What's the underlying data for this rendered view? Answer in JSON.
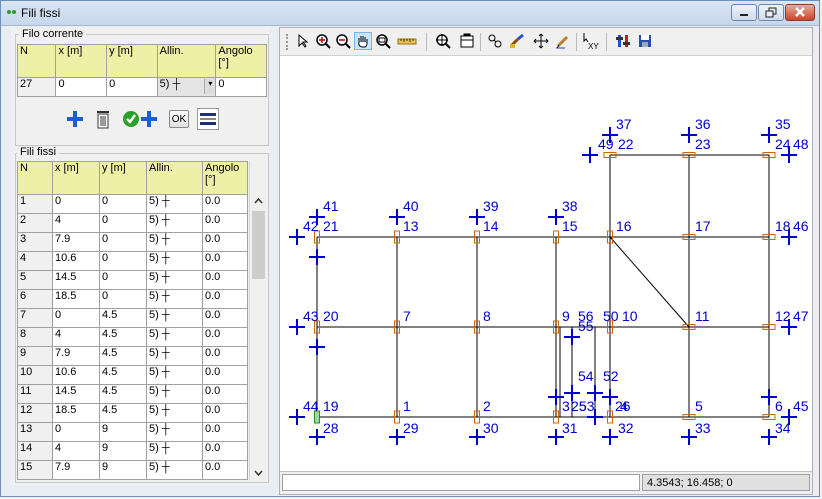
{
  "window": {
    "title": "Fili fissi"
  },
  "current": {
    "group_title": "Filo corrente",
    "headers": [
      "N",
      "x [m]",
      "y [m]",
      "Allin.",
      "Angolo [°]"
    ],
    "row": [
      "27",
      "0",
      "0",
      "5) ┼",
      "0"
    ]
  },
  "buttons": {
    "ok_label": "OK"
  },
  "list": {
    "group_title": "Fili fissi",
    "headers": [
      "N",
      "x [m]",
      "y [m]",
      "Allin.",
      "Angolo [°]"
    ],
    "rows": [
      [
        "1",
        "0",
        "0",
        "5) ┼",
        "0.0"
      ],
      [
        "2",
        "4",
        "0",
        "5) ┼",
        "0.0"
      ],
      [
        "3",
        "7.9",
        "0",
        "5) ┼",
        "0.0"
      ],
      [
        "4",
        "10.6",
        "0",
        "5) ┼",
        "0.0"
      ],
      [
        "5",
        "14.5",
        "0",
        "5) ┼",
        "0.0"
      ],
      [
        "6",
        "18.5",
        "0",
        "5) ┼",
        "0.0"
      ],
      [
        "7",
        "0",
        "4.5",
        "5) ┼",
        "0.0"
      ],
      [
        "8",
        "4",
        "4.5",
        "5) ┼",
        "0.0"
      ],
      [
        "9",
        "7.9",
        "4.5",
        "5) ┼",
        "0.0"
      ],
      [
        "10",
        "10.6",
        "4.5",
        "5) ┼",
        "0.0"
      ],
      [
        "11",
        "14.5",
        "4.5",
        "5) ┼",
        "0.0"
      ],
      [
        "12",
        "18.5",
        "4.5",
        "5) ┼",
        "0.0"
      ],
      [
        "13",
        "0",
        "9",
        "5) ┼",
        "0.0"
      ],
      [
        "14",
        "4",
        "9",
        "5) ┼",
        "0.0"
      ],
      [
        "15",
        "7.9",
        "9",
        "5) ┼",
        "0.0"
      ]
    ]
  },
  "toolbar": {
    "tools": [
      "select-arrow-icon",
      "zoom-in-icon",
      "zoom-out-icon",
      "pan-hand-icon",
      "zoom-window-icon",
      "measure-ruler-icon",
      "zoom-extents-icon",
      "zoom-previous-icon",
      "snap-icon",
      "paint-icon",
      "move-icon",
      "pencil-icon",
      "pick-xy-icon",
      "settings-icon",
      "save-icon"
    ]
  },
  "canvas": {
    "labels": [
      "1",
      "2",
      "3",
      "4",
      "5",
      "6",
      "7",
      "8",
      "9",
      "10",
      "11",
      "12",
      "13",
      "14",
      "15",
      "16",
      "17",
      "18",
      "19",
      "20",
      "21",
      "22",
      "23",
      "24",
      "25",
      "26",
      "28",
      "29",
      "30",
      "31",
      "32",
      "33",
      "34",
      "35",
      "36",
      "37",
      "38",
      "39",
      "40",
      "41",
      "42",
      "43",
      "44",
      "45",
      "46",
      "47",
      "48",
      "49",
      "50",
      "52",
      "53",
      "54",
      "55",
      "56"
    ]
  },
  "status": {
    "coords": "4.3543; 16.458; 0"
  },
  "colors": {
    "accent": "#0000cc",
    "header_bg": "#eef0a8",
    "marker": "#cc6600"
  }
}
